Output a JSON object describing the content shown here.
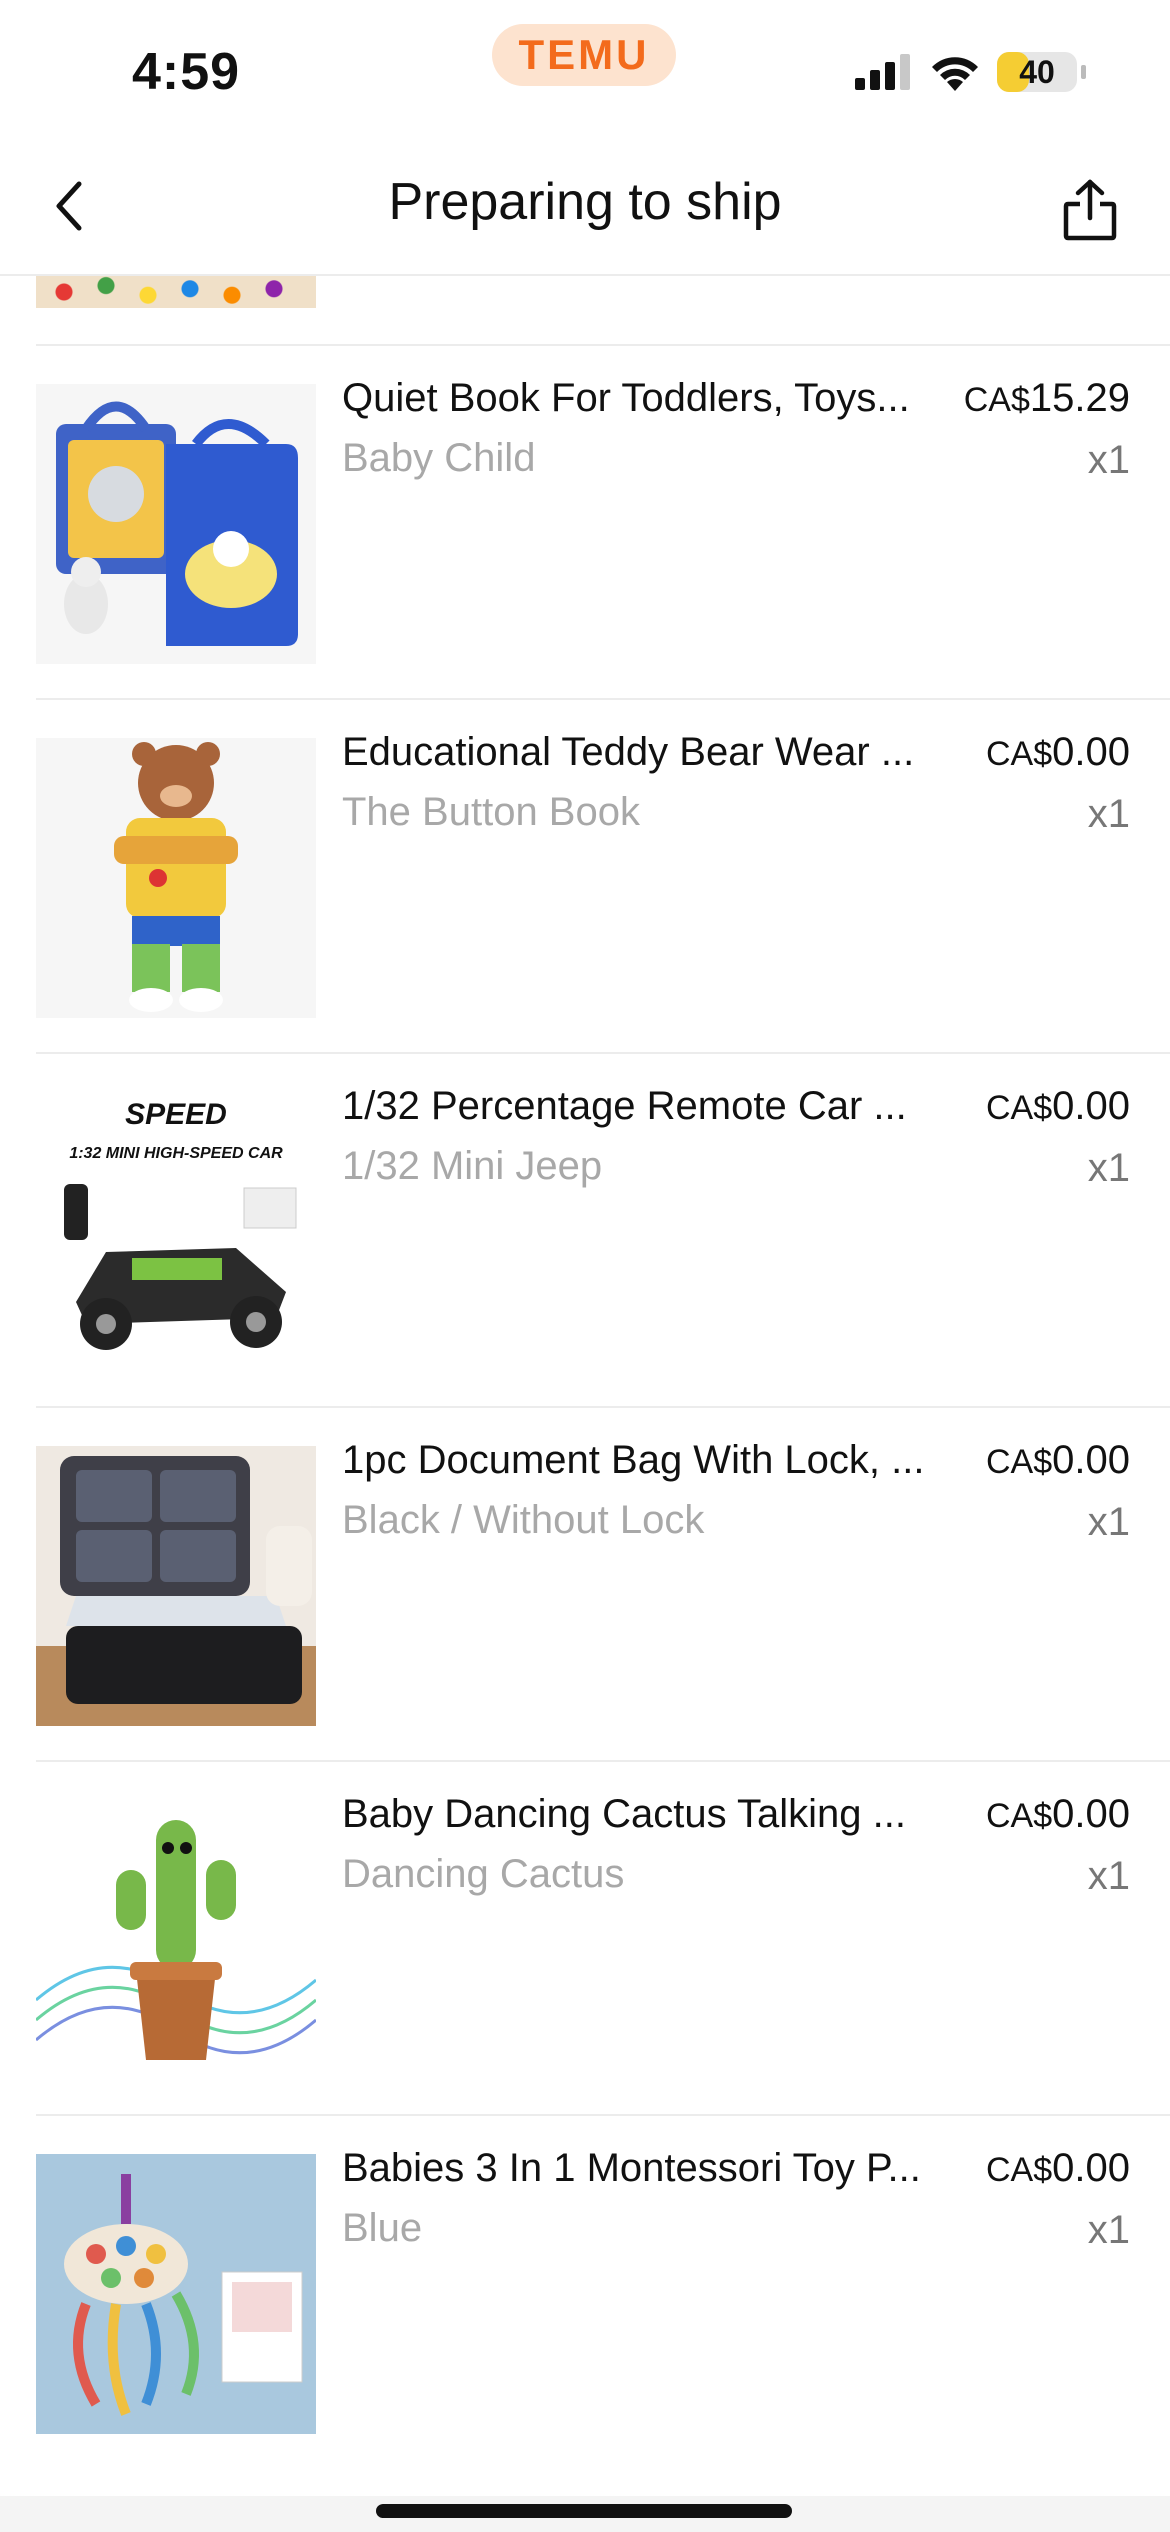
{
  "status_bar": {
    "time": "4:59",
    "app_badge": "TEMU",
    "battery": "40"
  },
  "nav": {
    "title": "Preparing to ship"
  },
  "items": [
    {
      "title": "Quiet Book For Toddlers, Toys...",
      "currency": "CA$",
      "amount": "15.29",
      "variant": "Baby Child",
      "qty": "x1",
      "thumb_icon": "quiet-book-image"
    },
    {
      "title": "Educational Teddy Bear Wear ...",
      "currency": "CA$",
      "amount": "0.00",
      "variant": "The Button Book",
      "qty": "x1",
      "thumb_icon": "teddy-bear-image"
    },
    {
      "title": "1/32 Percentage Remote Car ...",
      "currency": "CA$",
      "amount": "0.00",
      "variant": "1/32 Mini Jeep",
      "qty": "x1",
      "thumb_icon": "remote-car-image",
      "thumb_text": [
        "SPEED",
        "1:32 MINI HIGH-SPEED CAR"
      ]
    },
    {
      "title": "1pc Document Bag With Lock, ...",
      "currency": "CA$",
      "amount": "0.00",
      "variant": "Black / Without Lock",
      "qty": "x1",
      "thumb_icon": "document-bag-image"
    },
    {
      "title": "Baby Dancing Cactus Talking ...",
      "currency": "CA$",
      "amount": "0.00",
      "variant": "Dancing Cactus",
      "qty": "x1",
      "thumb_icon": "dancing-cactus-image"
    },
    {
      "title": "Babies 3 In 1 Montessori Toy P...",
      "currency": "CA$",
      "amount": "0.00",
      "variant": "Blue",
      "qty": "x1",
      "thumb_icon": "montessori-toy-image"
    }
  ]
}
